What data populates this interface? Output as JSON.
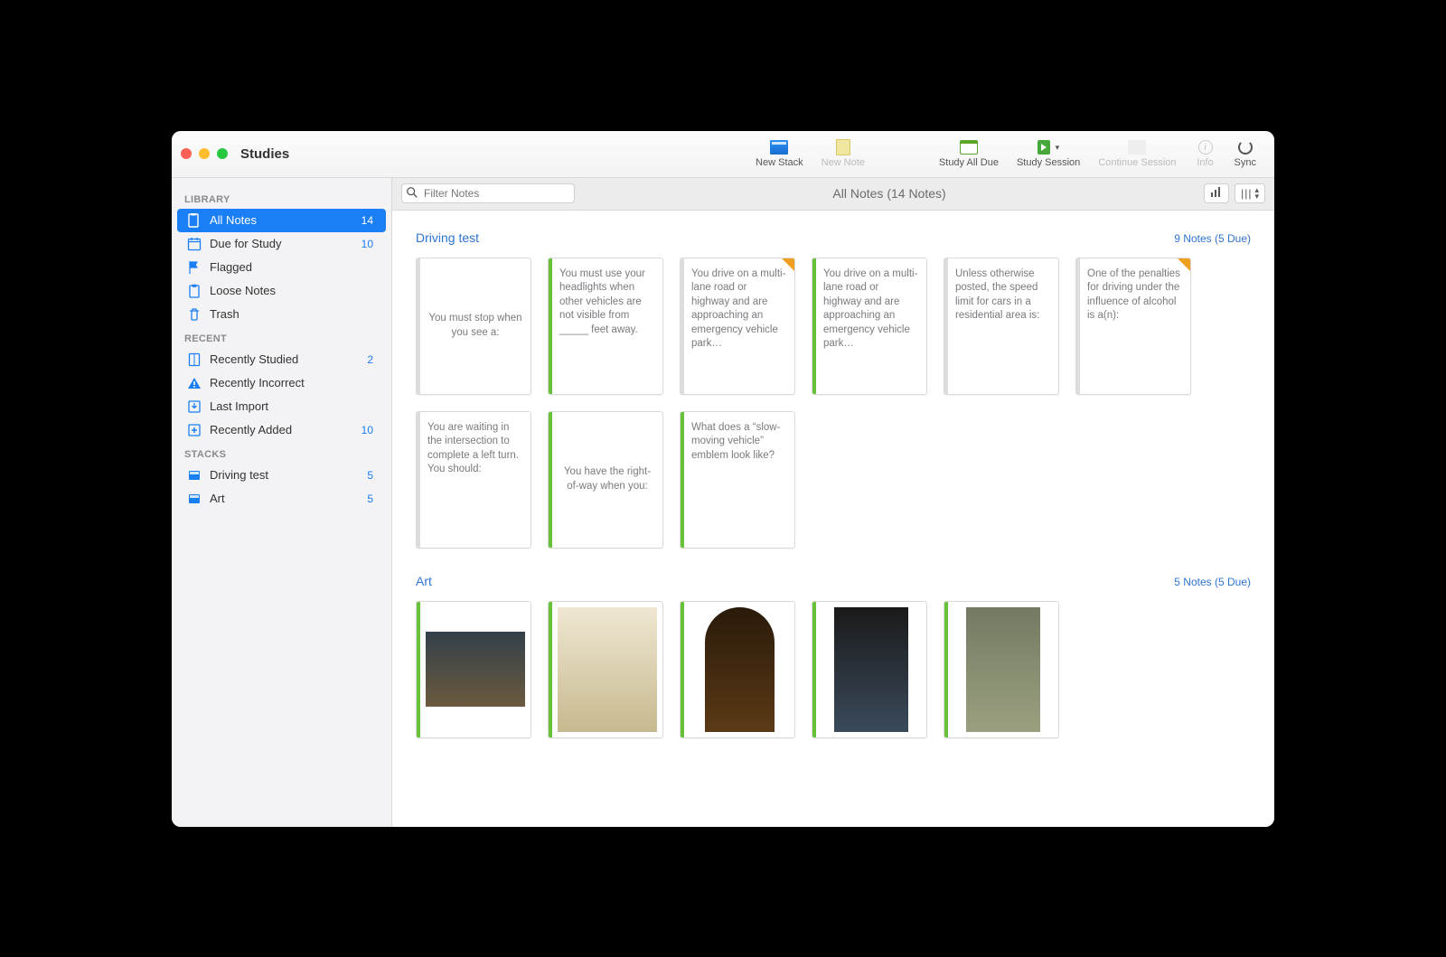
{
  "app_title": "Studies",
  "toolbar": {
    "new_stack": "New Stack",
    "new_note": "New Note",
    "study_all_due": "Study All Due",
    "study_session": "Study Session",
    "continue_session": "Continue Session",
    "info": "Info",
    "sync": "Sync"
  },
  "subtoolbar": {
    "filter_placeholder": "Filter Notes",
    "title": "All Notes (14 Notes)"
  },
  "sidebar": {
    "library_header": "LIBRARY",
    "library": [
      {
        "label": "All Notes",
        "count": "14"
      },
      {
        "label": "Due for Study",
        "count": "10"
      },
      {
        "label": "Flagged",
        "count": ""
      },
      {
        "label": "Loose Notes",
        "count": ""
      },
      {
        "label": "Trash",
        "count": ""
      }
    ],
    "recent_header": "RECENT",
    "recent": [
      {
        "label": "Recently Studied",
        "count": "2"
      },
      {
        "label": "Recently Incorrect",
        "count": ""
      },
      {
        "label": "Last Import",
        "count": ""
      },
      {
        "label": "Recently Added",
        "count": "10"
      }
    ],
    "stacks_header": "STACKS",
    "stacks": [
      {
        "label": "Driving test",
        "count": "5"
      },
      {
        "label": "Art",
        "count": "5"
      }
    ]
  },
  "sections": {
    "driving": {
      "title": "Driving test",
      "summary": "9 Notes (5 Due)",
      "cards": [
        "You must stop when you see a:",
        "You must use your headlights when other vehicles are not visible from _____ feet away.",
        "You drive on a multi-lane road or highway and are approaching an emergency vehicle park…",
        "You drive on a multi-lane road or highway and are approaching an emergency vehicle park…",
        "Unless otherwise posted, the speed limit for cars in a residential area is:",
        "One of the penalties for driving under the influence of alcohol is a(n):",
        "You are waiting in the intersection to complete a left turn. You should:",
        "You have the right-of-way when you:",
        "What does a “slow-moving vehicle” emblem look like?"
      ]
    },
    "art": {
      "title": "Art",
      "summary": "5 Notes (5 Due)"
    }
  }
}
